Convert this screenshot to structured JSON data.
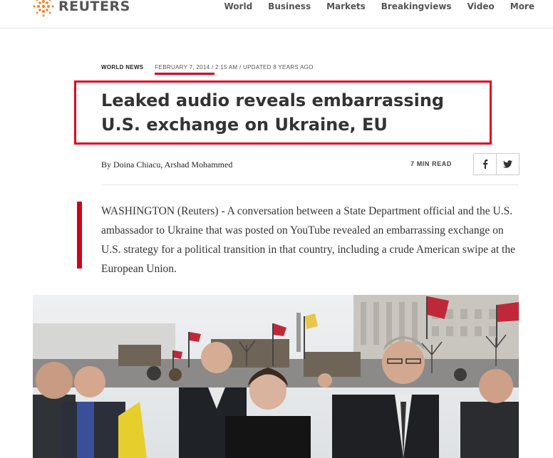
{
  "header": {
    "logo_text": "REUTERS",
    "nav": [
      "World",
      "Business",
      "Markets",
      "Breakingviews",
      "Video",
      "More"
    ]
  },
  "article": {
    "section": "WORLD NEWS",
    "date": "FEBRUARY 7, 2014",
    "time_updated": " / 2:15 AM / UPDATED 8 YEARS AGO",
    "headline": "Leaked audio reveals embarrassing U.S. exchange on Ukraine, EU",
    "byline_prefix": "By ",
    "byline_authors": "Doina Chiacu, Arshad Mohammed",
    "read_time": "7 MIN READ",
    "lead": "WASHINGTON (Reuters) - A conversation between a State Department official and the U.S. ambassador to Ukraine that was posted on YouTube revealed an embarrassing exchange on U.S. strategy for a political transition in that country, including a crude American swipe at the European Union."
  },
  "share": {
    "facebook_icon": "facebook-icon",
    "twitter_icon": "twitter-icon"
  },
  "colors": {
    "accent": "#d0021b",
    "highlight_box": "#e0061f",
    "logo_orange": "#f58025"
  }
}
